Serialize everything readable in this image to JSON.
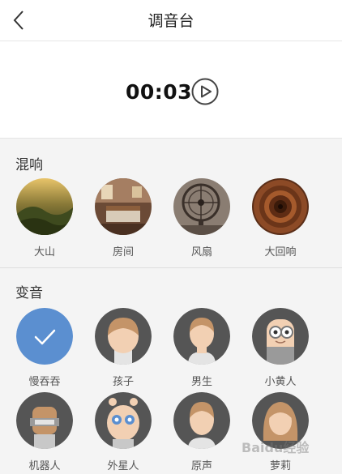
{
  "header": {
    "title": "调音台",
    "back_icon": "chevron-left-icon"
  },
  "player": {
    "time": "00:03",
    "play_icon": "play-circle-icon"
  },
  "reverb": {
    "title": "混响",
    "items": [
      {
        "label": "大山",
        "scene": "mountain"
      },
      {
        "label": "房间",
        "scene": "room"
      },
      {
        "label": "风扇",
        "scene": "fan"
      },
      {
        "label": "大回响",
        "scene": "tunnel"
      }
    ]
  },
  "voice": {
    "title": "变音",
    "items": [
      {
        "label": "慢吞吞",
        "selected": true
      },
      {
        "label": "孩子"
      },
      {
        "label": "男生"
      },
      {
        "label": "小黄人"
      },
      {
        "label": "机器人"
      },
      {
        "label": "外星人"
      },
      {
        "label": "原声"
      },
      {
        "label": "萝莉"
      }
    ]
  },
  "colors": {
    "accent": "#5b8fd0",
    "avatar_ring": "#555555",
    "skin": "#f2d0b3",
    "hair": "#c49468"
  },
  "watermark": "Baidu经验"
}
